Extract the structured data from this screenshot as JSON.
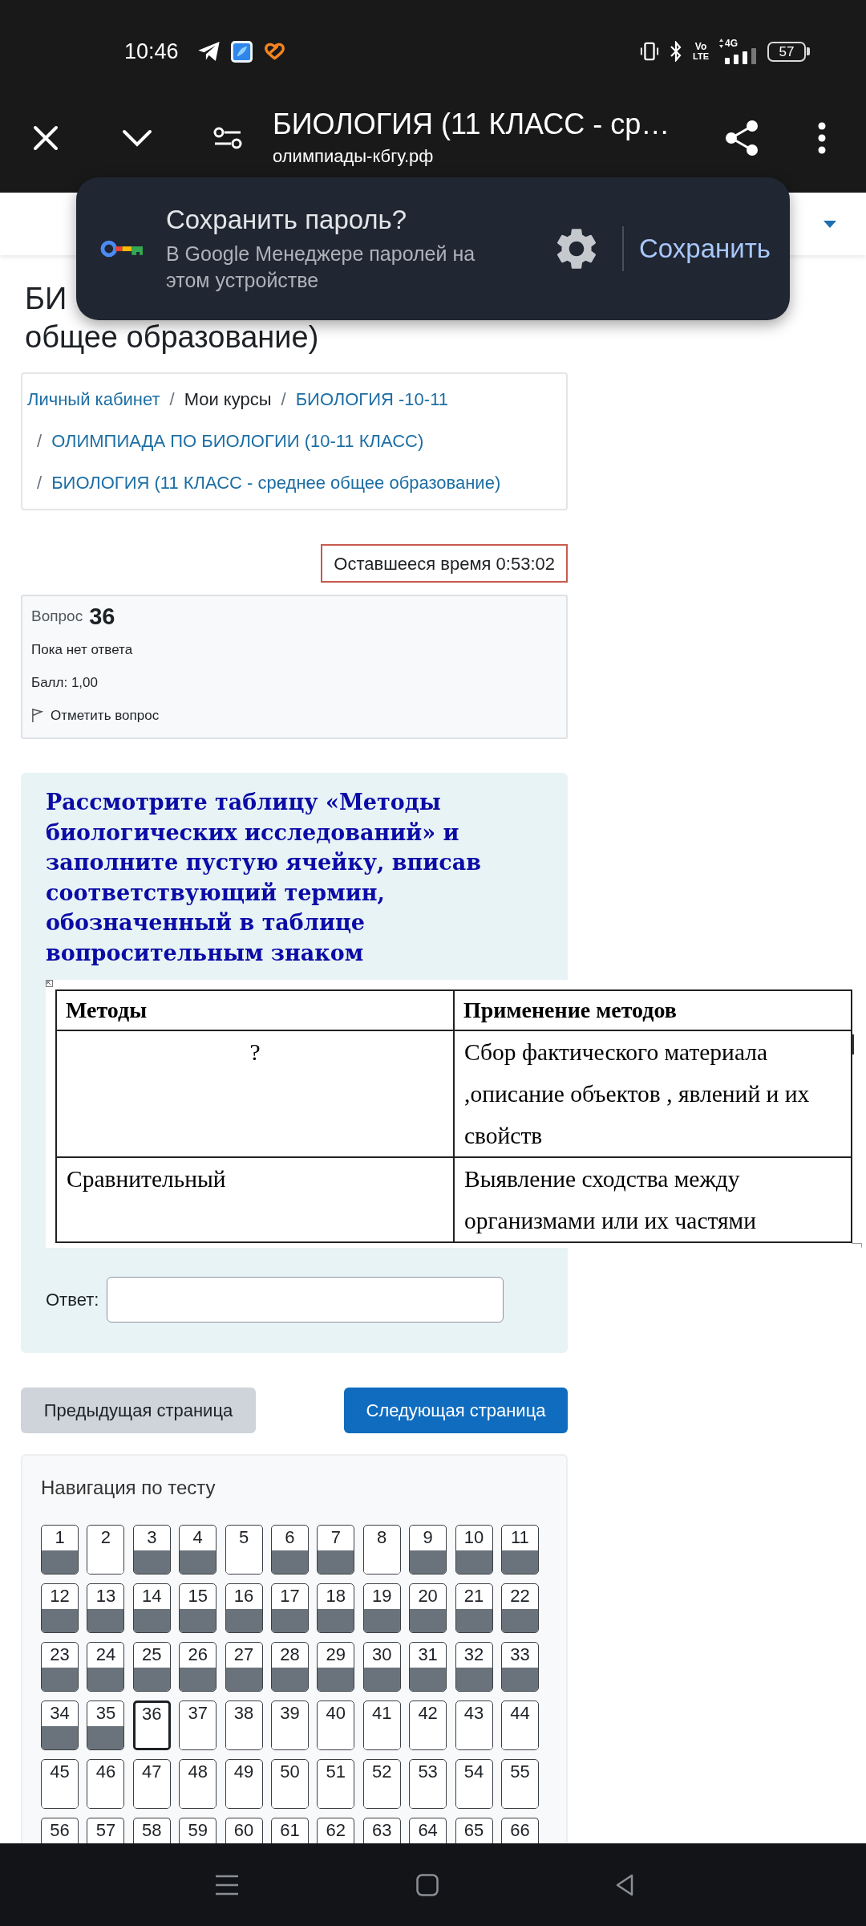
{
  "status_bar": {
    "time": "10:46",
    "volte_top": "Vo",
    "volte_bottom": "LTE",
    "network_type": "4G",
    "battery": "57"
  },
  "browser_toolbar": {
    "title": "БИОЛОГИЯ (11 КЛАСС - ср…",
    "url": "олимпиады-кбгу.рф"
  },
  "password_prompt": {
    "title": "Сохранить пароль?",
    "subtitle": "В Google Менеджере паролей на этом устройстве",
    "save_button": "Сохранить"
  },
  "page_heading": {
    "visible_start": "БИ",
    "line_2": "общее образование)"
  },
  "breadcrumbs": [
    {
      "label": "Личный кабинет",
      "kind": "link"
    },
    {
      "separator": "/",
      "label": "Мои курсы",
      "kind": "text"
    },
    {
      "separator": "/",
      "label": "БИОЛОГИЯ -10-11",
      "kind": "link"
    },
    {
      "separator": "/",
      "label": "ОЛИМПИАДА ПО БИОЛОГИИ (10-11 КЛАСС)",
      "kind": "link"
    },
    {
      "separator": "/",
      "label": "БИОЛОГИЯ (11 КЛАСС - среднее общее образование)",
      "kind": "link"
    }
  ],
  "timer": "Оставшееся время 0:53:02",
  "question_info": {
    "label": "Вопрос",
    "number": "36",
    "status": "Пока нет ответа",
    "grade": "Балл: 1,00",
    "flag_label": "Отметить вопрос"
  },
  "question": {
    "text": "Рассмотрите таблицу «Методы биологических исследований» и заполните пустую ячейку, вписав соответствующий термин, обозначенный в таблице вопросительным знаком",
    "table": {
      "columns": [
        "Методы",
        "Применение методов"
      ],
      "rows": [
        [
          {
            "text": "?",
            "kind": "blank"
          },
          {
            "text": "Сбор фактического материала ,описание объектов , явлений и их свойств",
            "kind": "text"
          }
        ],
        [
          {
            "text": "Сравнительный",
            "kind": "text"
          },
          {
            "text": "Выявление сходства между организмами или их частями",
            "kind": "text"
          }
        ]
      ]
    },
    "answer_label": "Ответ:"
  },
  "page_buttons": {
    "previous": "Предыдущая страница",
    "next": "Следующая страница"
  },
  "quiz_navigation": {
    "title": "Навигация по тесту",
    "items": [
      {
        "label": "1",
        "answered": true,
        "selected": false
      },
      {
        "label": "2",
        "answered": false,
        "selected": false
      },
      {
        "label": "3",
        "answered": true,
        "selected": false
      },
      {
        "label": "4",
        "answered": true,
        "selected": false
      },
      {
        "label": "5",
        "answered": false,
        "selected": false
      },
      {
        "label": "6",
        "answered": true,
        "selected": false
      },
      {
        "label": "7",
        "answered": true,
        "selected": false
      },
      {
        "label": "8",
        "answered": false,
        "selected": false
      },
      {
        "label": "9",
        "answered": true,
        "selected": false
      },
      {
        "label": "10",
        "answered": true,
        "selected": false
      },
      {
        "label": "11",
        "answered": true,
        "selected": false
      },
      {
        "label": "12",
        "answered": true,
        "selected": false
      },
      {
        "label": "13",
        "answered": true,
        "selected": false
      },
      {
        "label": "14",
        "answered": true,
        "selected": false
      },
      {
        "label": "15",
        "answered": true,
        "selected": false
      },
      {
        "label": "16",
        "answered": true,
        "selected": false
      },
      {
        "label": "17",
        "answered": true,
        "selected": false
      },
      {
        "label": "18",
        "answered": true,
        "selected": false
      },
      {
        "label": "19",
        "answered": true,
        "selected": false
      },
      {
        "label": "20",
        "answered": true,
        "selected": false
      },
      {
        "label": "21",
        "answered": true,
        "selected": false
      },
      {
        "label": "22",
        "answered": true,
        "selected": false
      },
      {
        "label": "23",
        "answered": true,
        "selected": false
      },
      {
        "label": "24",
        "answered": true,
        "selected": false
      },
      {
        "label": "25",
        "answered": true,
        "selected": false
      },
      {
        "label": "26",
        "answered": true,
        "selected": false
      },
      {
        "label": "27",
        "answered": true,
        "selected": false
      },
      {
        "label": "28",
        "answered": true,
        "selected": false
      },
      {
        "label": "29",
        "answered": true,
        "selected": false
      },
      {
        "label": "30",
        "answered": true,
        "selected": false
      },
      {
        "label": "31",
        "answered": true,
        "selected": false
      },
      {
        "label": "32",
        "answered": true,
        "selected": false
      },
      {
        "label": "33",
        "answered": true,
        "selected": false
      },
      {
        "label": "34",
        "answered": true,
        "selected": false
      },
      {
        "label": "35",
        "answered": true,
        "selected": false
      },
      {
        "label": "36",
        "answered": false,
        "selected": true
      },
      {
        "label": "37",
        "answered": false,
        "selected": false
      },
      {
        "label": "38",
        "answered": false,
        "selected": false
      },
      {
        "label": "39",
        "answered": false,
        "selected": false
      },
      {
        "label": "40",
        "answered": false,
        "selected": false
      },
      {
        "label": "41",
        "answered": false,
        "selected": false
      },
      {
        "label": "42",
        "answered": false,
        "selected": false
      },
      {
        "label": "43",
        "answered": false,
        "selected": false
      },
      {
        "label": "44",
        "answered": false,
        "selected": false
      },
      {
        "label": "45",
        "answered": false,
        "selected": false
      },
      {
        "label": "46",
        "answered": false,
        "selected": false
      },
      {
        "label": "47",
        "answered": false,
        "selected": false
      },
      {
        "label": "48",
        "answered": false,
        "selected": false
      },
      {
        "label": "49",
        "answered": false,
        "selected": false
      },
      {
        "label": "50",
        "answered": false,
        "selected": false
      },
      {
        "label": "51",
        "answered": false,
        "selected": false
      },
      {
        "label": "52",
        "answered": false,
        "selected": false
      },
      {
        "label": "53",
        "answered": false,
        "selected": false
      },
      {
        "label": "54",
        "answered": false,
        "selected": false
      },
      {
        "label": "55",
        "answered": false,
        "selected": false
      },
      {
        "label": "56",
        "selected": false
      },
      {
        "label": "57",
        "selected": false
      },
      {
        "label": "58",
        "selected": false
      },
      {
        "label": "59",
        "selected": false
      },
      {
        "label": "60",
        "selected": false
      },
      {
        "label": "61",
        "selected": false
      },
      {
        "label": "62",
        "selected": false
      },
      {
        "label": "63",
        "selected": false
      },
      {
        "label": "64",
        "selected": false
      },
      {
        "label": "65",
        "selected": false
      },
      {
        "label": "66",
        "selected": false
      }
    ]
  }
}
